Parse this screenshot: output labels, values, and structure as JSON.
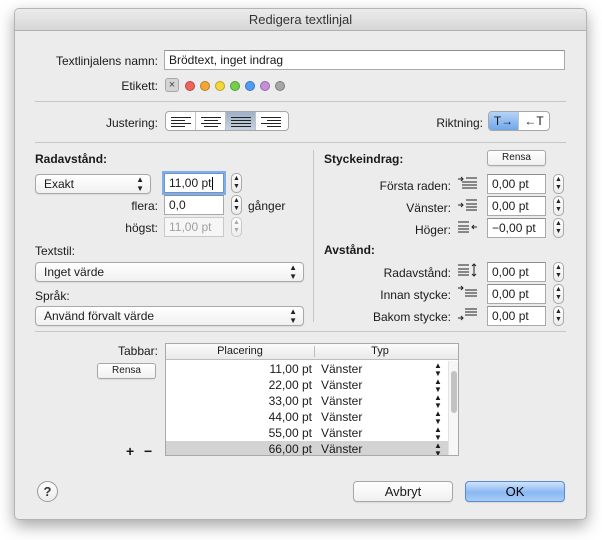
{
  "window": {
    "title": "Redigera textlinjal"
  },
  "name_field": {
    "label": "Textlinjalens namn:",
    "value": "Brödtext, inget indrag"
  },
  "tag": {
    "label": "Etikett:",
    "none_symbol": "×",
    "colors": [
      {
        "name": "red",
        "hex": "#f0635c"
      },
      {
        "name": "orange",
        "hex": "#f5a733"
      },
      {
        "name": "yellow",
        "hex": "#f3d838"
      },
      {
        "name": "green",
        "hex": "#72d04d"
      },
      {
        "name": "blue",
        "hex": "#4f9df6"
      },
      {
        "name": "purple",
        "hex": "#c58fdc"
      },
      {
        "name": "gray",
        "hex": "#a6a6a6"
      }
    ]
  },
  "alignment": {
    "label": "Justering:",
    "options": [
      "left",
      "center",
      "justify",
      "right"
    ],
    "selected": "justify"
  },
  "direction": {
    "label": "Riktning:",
    "ltr": "T→",
    "rtl": "←T",
    "selected": "ltr"
  },
  "line_spacing": {
    "heading": "Radavstånd:",
    "mode": "Exakt",
    "value": "11,00 pt",
    "multiple_label": "flera:",
    "multiple_value": "0,0",
    "multiple_unit": "gånger",
    "max_label": "högst:",
    "max_value": "11,00 pt"
  },
  "text_style": {
    "label": "Textstil:",
    "value": "Inget värde"
  },
  "language": {
    "label": "Språk:",
    "value": "Använd förvalt värde"
  },
  "indent": {
    "heading": "Styckeindrag:",
    "reset": "Rensa",
    "first_label": "Första raden:",
    "first_value": "0,00 pt",
    "left_label": "Vänster:",
    "left_value": "0,00 pt",
    "right_label": "Höger:",
    "right_value": "−0,00 pt"
  },
  "spacing": {
    "heading": "Avstånd:",
    "line_label": "Radavstånd:",
    "line_value": "0,00 pt",
    "before_label": "Innan stycke:",
    "before_value": "0,00 pt",
    "after_label": "Bakom stycke:",
    "after_value": "0,00 pt"
  },
  "tabs": {
    "label": "Tabbar:",
    "reset": "Rensa",
    "col_position": "Placering",
    "col_type": "Typ",
    "add": "+",
    "remove": "−",
    "rows": [
      {
        "position": "11,00 pt",
        "type": "Vänster"
      },
      {
        "position": "22,00 pt",
        "type": "Vänster"
      },
      {
        "position": "33,00 pt",
        "type": "Vänster"
      },
      {
        "position": "44,00 pt",
        "type": "Vänster"
      },
      {
        "position": "55,00 pt",
        "type": "Vänster"
      },
      {
        "position": "66,00 pt",
        "type": "Vänster"
      }
    ],
    "selected_index": 5
  },
  "footer": {
    "help": "?",
    "cancel": "Avbryt",
    "ok": "OK"
  }
}
